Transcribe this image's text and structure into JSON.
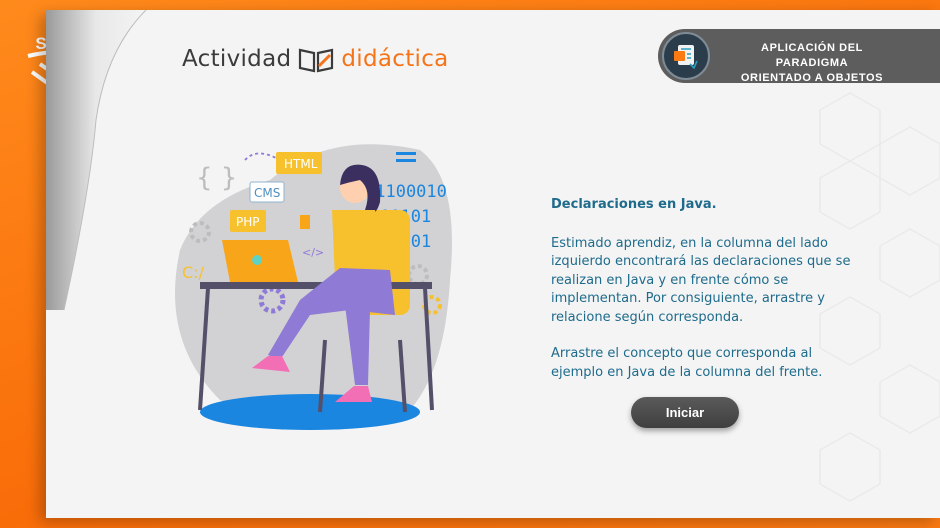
{
  "logo": {
    "text": "SENA"
  },
  "brand": {
    "part1": "Actividad",
    "part2": "didáctica"
  },
  "header": {
    "line1": "APLICACIÓN DEL PARADIGMA",
    "line2": "ORIENTADO A OBJETOS"
  },
  "illustration": {
    "html_tag": "HTML",
    "cms_tag": "CMS",
    "php_tag": "PHP",
    "binary1": "11100010",
    "binary2": "00101",
    "binary3": "01101",
    "path": "C:/",
    "code": "</>",
    "braces": "{ }"
  },
  "main": {
    "title": "Declaraciones en Java.",
    "para1": "Estimado aprendiz, en la columna del lado izquierdo encontrará las declaraciones que se realizan en Java y en frente cómo se implementan. Por consiguiente, arrastre y relacione según corresponda.",
    "para2": "Arrastre el concepto que corresponda al ejemplo en Java de la columna del frente."
  },
  "start_button": {
    "label": "Iniciar"
  },
  "colors": {
    "orange": "#fb7a12",
    "teal_text": "#1e6b8c",
    "pill_gray": "#5d5d5d",
    "button_gray": "#4a4a4a"
  }
}
